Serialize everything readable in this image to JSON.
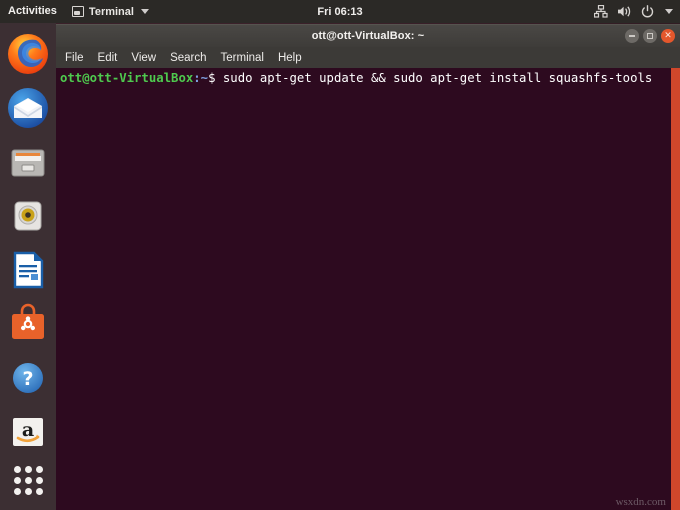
{
  "topbar": {
    "activities": "Activities",
    "app_name": "Terminal",
    "app_icon": "window-icon",
    "caret_icon": "chevron-down-icon",
    "clock": "Fri 06:13",
    "right_icons": [
      {
        "name": "network-icon",
        "label": "Network"
      },
      {
        "name": "volume-icon",
        "label": "Volume"
      },
      {
        "name": "power-icon",
        "label": "Power"
      },
      {
        "name": "chevron-down-icon",
        "label": "System menu"
      }
    ],
    "background": "#2b2926"
  },
  "dock": {
    "background": "#3c2f33",
    "items": [
      {
        "name": "dock-item-firefox",
        "label": "Firefox"
      },
      {
        "name": "dock-item-thunderbird",
        "label": "Thunderbird Mail"
      },
      {
        "name": "dock-item-files",
        "label": "Files"
      },
      {
        "name": "dock-item-rhythmbox",
        "label": "Rhythmbox"
      },
      {
        "name": "dock-item-libreoffice-writer",
        "label": "LibreOffice Writer"
      },
      {
        "name": "dock-item-ubuntu-software",
        "label": "Ubuntu Software"
      },
      {
        "name": "dock-item-help",
        "label": "Help"
      },
      {
        "name": "dock-item-amazon",
        "label": "Amazon"
      }
    ],
    "show_apps": {
      "name": "show-applications-button",
      "label": "Show Applications"
    }
  },
  "terminal": {
    "title": "ott@ott-VirtualBox: ~",
    "window_buttons": {
      "minimize": "Minimize",
      "maximize": "Maximize",
      "close": "Close"
    },
    "menu": [
      {
        "label": "File"
      },
      {
        "label": "Edit"
      },
      {
        "label": "View"
      },
      {
        "label": "Search"
      },
      {
        "label": "Terminal"
      },
      {
        "label": "Help"
      }
    ],
    "background": "#2d0a1f",
    "scrollbar_color": "#d0472b",
    "prompt": {
      "user_host": "ott@ott-VirtualBox",
      "separator": ":",
      "path": "~",
      "symbol": "$"
    },
    "command": "sudo apt-get update && sudo apt-get install squashfs-tools",
    "watermark": "wsxdn.com"
  }
}
